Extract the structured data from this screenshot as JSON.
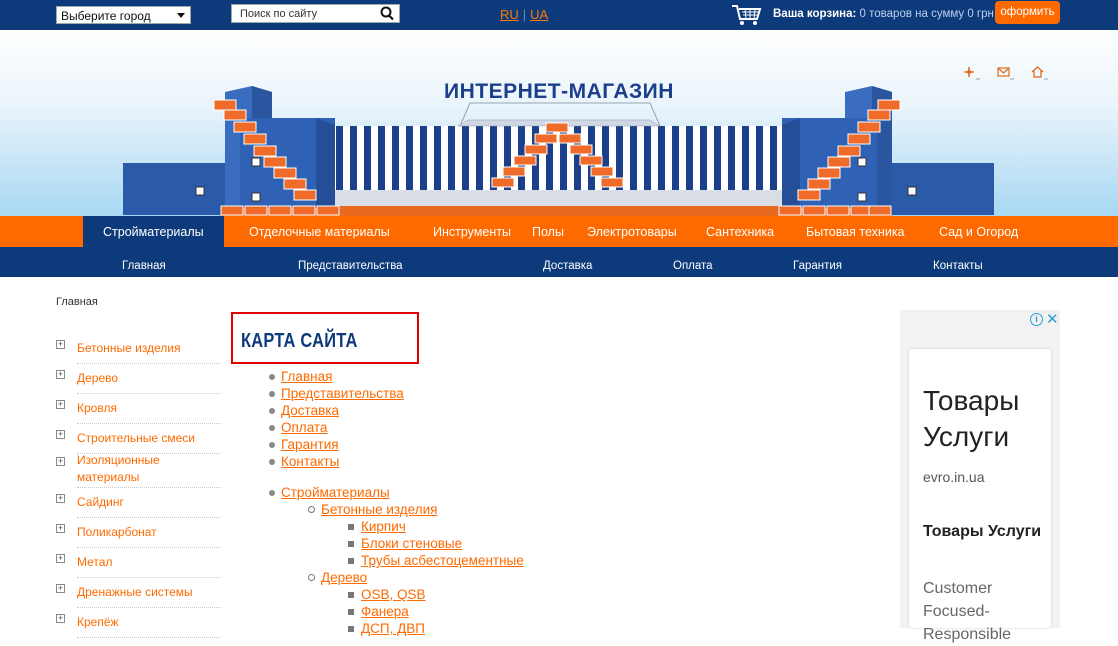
{
  "topbar": {
    "city_select": "Выберите город",
    "search_placeholder": "Поиск по сайту",
    "lang_ru": "RU",
    "lang_separator": "|",
    "lang_ua": "UA",
    "cart_label": "Ваша корзина:",
    "cart_value": "0 товаров на сумму 0 грн",
    "checkout_label": "оформить"
  },
  "banner": {
    "logo_text": "ИНТЕРНЕТ-МАГАЗИН"
  },
  "main_nav": [
    {
      "label": "Стройматериалы",
      "active": true
    },
    {
      "label": "Отделочные материалы"
    },
    {
      "label": "Инструменты"
    },
    {
      "label": "Полы"
    },
    {
      "label": "Электротовары"
    },
    {
      "label": "Сантехника"
    },
    {
      "label": "Бытовая техника"
    },
    {
      "label": "Сад и Огород"
    }
  ],
  "sub_nav": [
    {
      "label": "Главная"
    },
    {
      "label": "Представительства"
    },
    {
      "label": "Доставка"
    },
    {
      "label": "Оплата"
    },
    {
      "label": "Гарантия"
    },
    {
      "label": "Контакты"
    }
  ],
  "breadcrumb": "Главная",
  "sidebar": {
    "categories": [
      {
        "label": "Бетонные изделия"
      },
      {
        "label": "Дерево"
      },
      {
        "label": "Кровля"
      },
      {
        "label": "Строительные смеси"
      },
      {
        "label": "Изоляционные материалы"
      },
      {
        "label": "Сайдинг"
      },
      {
        "label": "Поликарбонат"
      },
      {
        "label": "Метал"
      },
      {
        "label": "Дренажные системы"
      },
      {
        "label": "Крепёж"
      }
    ]
  },
  "content": {
    "title": "КАРТА САЙТА",
    "sitemap_top": [
      "Главная",
      "Представительства",
      "Доставка",
      "Оплата",
      "Гарантия",
      "Контакты"
    ],
    "sitemap_tree": {
      "root": "Стройматериалы",
      "groups": [
        {
          "label": "Бетонные изделия",
          "items": [
            "Кирпич",
            "Блоки стеновые",
            "Трубы асбестоцементные"
          ]
        },
        {
          "label": "Дерево",
          "items": [
            "OSB, QSB",
            "Фанера",
            "ДСП, ДВП"
          ]
        }
      ]
    }
  },
  "ad": {
    "info": "i",
    "close": "✕",
    "headline": "Товары Услуги",
    "domain": "evro.in.ua",
    "subhead": "Товары Услуги",
    "body": "Customer Focused-Responsible"
  },
  "colors": {
    "navy": "#0d3a7a",
    "orange": "#ff6a00",
    "highlight_border": "#e00000"
  }
}
